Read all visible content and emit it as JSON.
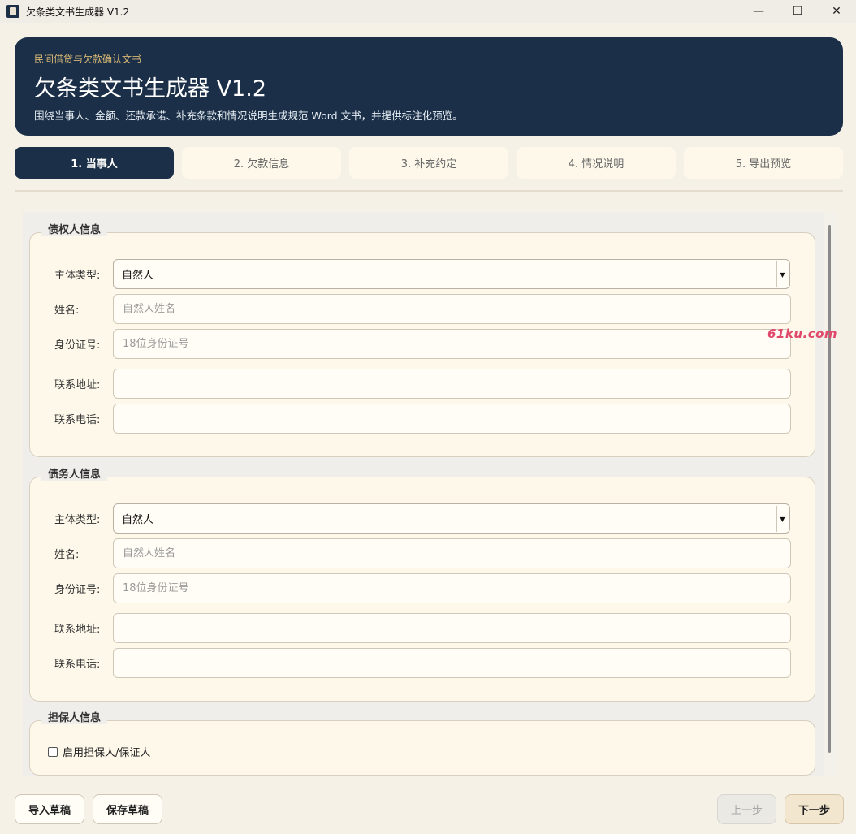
{
  "window": {
    "title": "欠条类文书生成器 V1.2",
    "controls": [
      "—",
      "☐",
      "✕"
    ]
  },
  "banner": {
    "kicker": "民间借贷与欠款确认文书",
    "title": "欠条类文书生成器 V1.2",
    "description": "围绕当事人、金额、还款承诺、补充条款和情况说明生成规范 Word 文书，并提供标注化预览。"
  },
  "steps": [
    {
      "label": "1. 当事人",
      "active": true
    },
    {
      "label": "2. 欠款信息",
      "active": false
    },
    {
      "label": "3. 补充约定",
      "active": false
    },
    {
      "label": "4. 情况说明",
      "active": false
    },
    {
      "label": "5. 导出预览",
      "active": false
    }
  ],
  "creditor": {
    "title": "债权人信息",
    "type_label": "主体类型:",
    "type_value": "自然人",
    "name_label": "姓名:",
    "name_placeholder": "自然人姓名",
    "id_label": "身份证号:",
    "id_placeholder": "18位身份证号",
    "address_label": "联系地址:",
    "phone_label": "联系电话:"
  },
  "debtor": {
    "title": "债务人信息",
    "type_label": "主体类型:",
    "type_value": "自然人",
    "name_label": "姓名:",
    "name_placeholder": "自然人姓名",
    "id_label": "身份证号:",
    "id_placeholder": "18位身份证号",
    "address_label": "联系地址:",
    "phone_label": "联系电话:"
  },
  "guarantor": {
    "title": "担保人信息",
    "enable_label": "启用担保人/保证人",
    "enabled": false
  },
  "watermark": "61ku.com",
  "footer": {
    "import_label": "导入草稿",
    "save_label": "保存草稿",
    "prev_label": "上一步",
    "next_label": "下一步"
  },
  "colors": {
    "primary": "#1b3048",
    "accent": "#d7b774",
    "background": "#f6f1e7",
    "panel": "#fdf8ea"
  }
}
